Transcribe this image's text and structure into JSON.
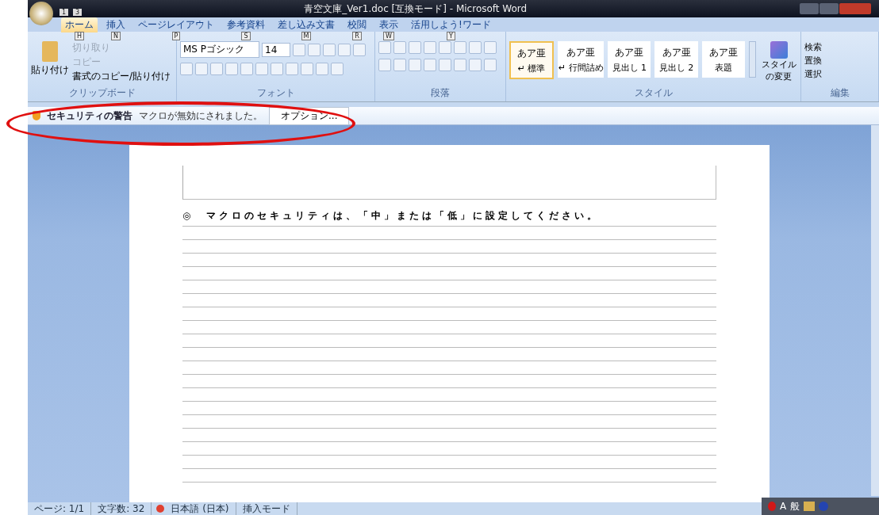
{
  "window": {
    "title": "青空文庫_Ver1.doc [互換モード] - Microsoft Word"
  },
  "quick_access_keytips": [
    "1",
    "3"
  ],
  "tabs": [
    {
      "label": "ホーム",
      "keytip": "H",
      "selected": true
    },
    {
      "label": "挿入",
      "keytip": "N",
      "selected": false
    },
    {
      "label": "ページレイアウト",
      "keytip": "P",
      "selected": false
    },
    {
      "label": "参考資料",
      "keytip": "S",
      "selected": false
    },
    {
      "label": "差し込み文書",
      "keytip": "M",
      "selected": false
    },
    {
      "label": "校閲",
      "keytip": "R",
      "selected": false
    },
    {
      "label": "表示",
      "keytip": "W",
      "selected": false
    },
    {
      "label": "活用しよう!ワード",
      "keytip": "Y",
      "selected": false
    }
  ],
  "ribbon": {
    "clipboard": {
      "paste_label": "貼り付け",
      "items": [
        {
          "label": "切り取り",
          "disabled": true
        },
        {
          "label": "コピー",
          "disabled": true
        },
        {
          "label": "書式のコピー/貼り付け",
          "disabled": false
        }
      ],
      "label": "クリップボード"
    },
    "font": {
      "font_name": "MS Pゴシック",
      "font_size": "14",
      "label": "フォント"
    },
    "paragraph": {
      "label": "段落"
    },
    "styles": {
      "items": [
        {
          "preview": "あア亜",
          "name": "↵ 標準",
          "selected": true
        },
        {
          "preview": "あア亜",
          "name": "↵ 行間詰め",
          "selected": false
        },
        {
          "preview": "あア亜",
          "name": "見出し 1",
          "selected": false
        },
        {
          "preview": "あア亜",
          "name": "見出し 2",
          "selected": false
        },
        {
          "preview": "あア亜",
          "name": "表題",
          "selected": false
        }
      ],
      "change_label": "スタイルの変更",
      "label": "スタイル"
    },
    "editing": {
      "items": [
        "検索",
        "置換",
        "選択"
      ],
      "label": "編集"
    }
  },
  "security_bar": {
    "title": "セキュリティの警告",
    "message": "マクロが無効にされました。",
    "button": "オプション..."
  },
  "document": {
    "lines": [
      "◎　マクロのセキュリティは、「中」または「低」に設定してください。"
    ]
  },
  "status_bar": [
    "ページ: 1/1",
    "文字数: 32",
    "日本語 (日本)",
    "挿入モード"
  ],
  "ime_bar": [
    "A",
    "般"
  ]
}
